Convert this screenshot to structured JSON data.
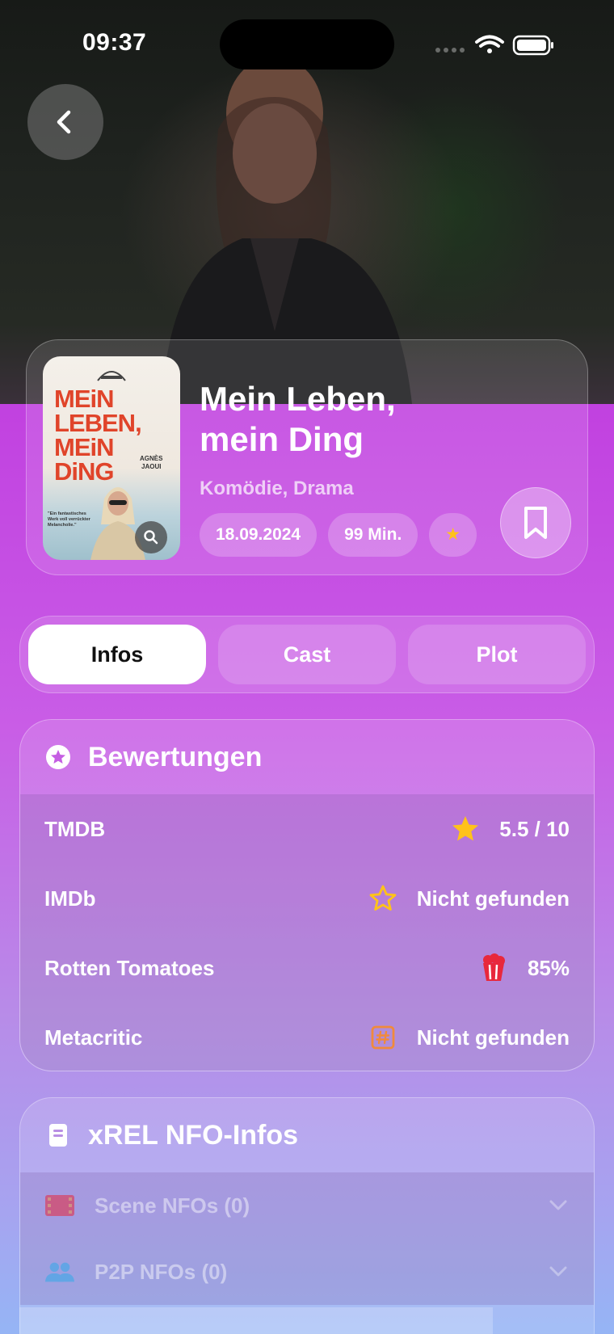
{
  "status_bar": {
    "time": "09:37"
  },
  "movie": {
    "title": "Mein Leben, mein Ding",
    "genres": "Komödie, Drama",
    "chips": [
      "18.09.2024",
      "99 Min.",
      "★"
    ]
  },
  "poster": {
    "title_lines": [
      "MEiN",
      "LEBEN,",
      "MEiN",
      "DiNG"
    ],
    "author_lines": [
      "AGNÈS",
      "JAOUI"
    ],
    "quote": "\"Ein fantastisches Werk voll verrückter Melancholie.\""
  },
  "tabs": [
    {
      "label": "Infos",
      "active": true
    },
    {
      "label": "Cast",
      "active": false
    },
    {
      "label": "Plot",
      "active": false
    }
  ],
  "ratings": {
    "title": "Bewertungen",
    "rows": [
      {
        "source": "TMDB",
        "value": "5.5 / 10",
        "icon": "star-filled-icon"
      },
      {
        "source": "IMDb",
        "value": "Nicht gefunden",
        "icon": "star-outline-icon"
      },
      {
        "source": "Rotten Tomatoes",
        "value": "85%",
        "icon": "popcorn-icon"
      },
      {
        "source": "Metacritic",
        "value": "Nicht gefunden",
        "icon": "hash-square-icon"
      }
    ]
  },
  "nfo": {
    "title": "xREL NFO-Infos",
    "rows": [
      {
        "label": "Scene NFOs (0)",
        "icon": "film-strip-icon"
      },
      {
        "label": "P2P NFOs (0)",
        "icon": "people-icon"
      }
    ]
  },
  "colors": {
    "accent_star": "#ffc21a",
    "tomato_red": "#e8283c",
    "metacritic_orange": "#f08a3c",
    "p2p_blue": "#4aa8e8"
  }
}
